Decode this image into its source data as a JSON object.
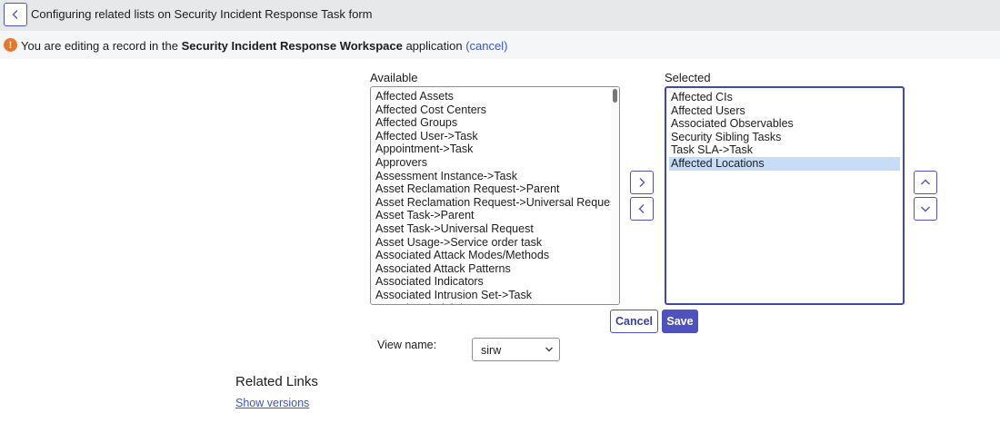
{
  "header": {
    "title": "Configuring related lists on Security Incident Response Task form",
    "back_icon": "chevron-left-icon"
  },
  "notice": {
    "icon": "warning-icon",
    "text_prefix": "You are editing a record in the ",
    "app_name": "Security Incident Response Workspace",
    "text_suffix": " application ",
    "cancel_link": "(cancel)",
    "icon_glyph": "!",
    "color": "#e8772e"
  },
  "available": {
    "label": "Available",
    "items": [
      "Affected Assets",
      "Affected Cost Centers",
      "Affected Groups",
      "Affected User->Task",
      "Appointment->Task",
      "Approvers",
      "Assessment Instance->Task",
      "Asset Reclamation Request->Parent",
      "Asset Reclamation Request->Universal Request",
      "Asset Task->Parent",
      "Asset Task->Universal Request",
      "Asset Usage->Service order task",
      "Associated Attack Modes/Methods",
      "Associated Attack Patterns",
      "Associated Indicators",
      "Associated Intrusion Set->Task",
      "Associated Sightings"
    ]
  },
  "selected": {
    "label": "Selected",
    "items": [
      "Affected CIs",
      "Affected Users",
      "Associated Observables",
      "Security Sibling Tasks",
      "Task SLA->Task",
      "Affected Locations"
    ],
    "highlighted_index": 5
  },
  "actions": {
    "cancel_label": "Cancel",
    "save_label": "Save"
  },
  "view": {
    "label": "View name:",
    "value": "sirw"
  },
  "related_links": {
    "title": "Related Links",
    "show_versions": "Show versions"
  },
  "colors": {
    "accent": "#4f52bd",
    "link": "#3a57c4",
    "highlight": "#c7dcf7",
    "header_bg": "#e6e8ea"
  }
}
